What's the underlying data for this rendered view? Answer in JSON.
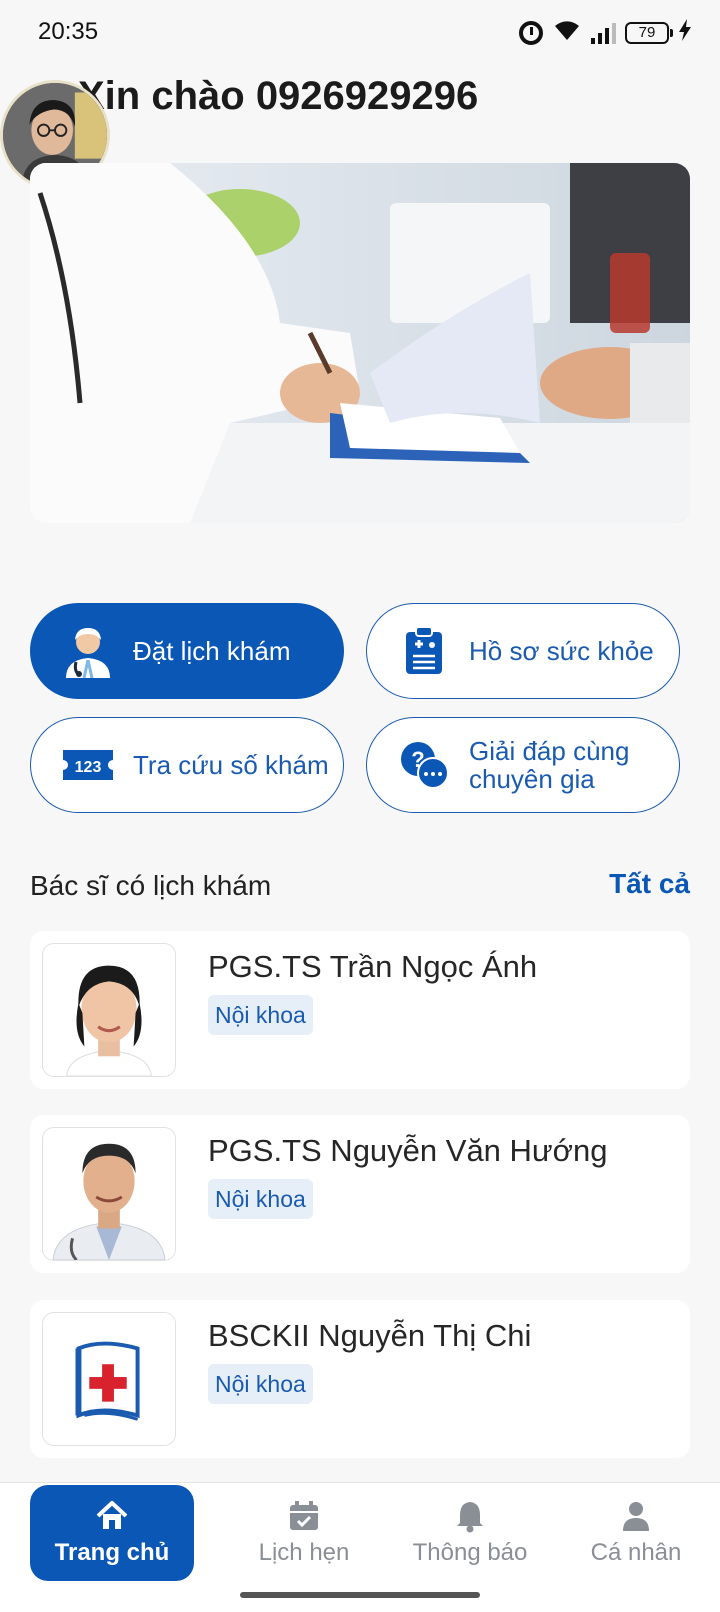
{
  "status_bar": {
    "time": "20:35",
    "battery": "79",
    "icons": [
      "alarm-icon",
      "wifi-icon",
      "signal-icon",
      "battery-icon",
      "charging-icon"
    ]
  },
  "header": {
    "greeting": "Xin chào 0926929296"
  },
  "actions": [
    {
      "label": "Đặt lịch khám",
      "icon": "doctor-icon",
      "primary": true
    },
    {
      "label": "Hồ sơ sức khỏe",
      "icon": "clipboard-icon",
      "primary": false
    },
    {
      "label": "Tra cứu số khám",
      "icon": "ticket-number-icon",
      "primary": false
    },
    {
      "label": "Giải đáp cùng chuyên gia",
      "icon": "question-chat-icon",
      "primary": false
    }
  ],
  "doctors_section": {
    "title": "Bác sĩ có lịch khám",
    "see_all": "Tất cả",
    "doctors": [
      {
        "name": "PGS.TS Trần Ngọc Ánh",
        "specialty": "Nội khoa"
      },
      {
        "name": "PGS.TS Nguyễn Văn Hướng",
        "specialty": "Nội khoa"
      },
      {
        "name": "BSCKII Nguyễn Thị Chi",
        "specialty": "Nội khoa"
      }
    ]
  },
  "bottom_nav": [
    {
      "label": "Trang chủ",
      "icon": "home-icon",
      "active": true
    },
    {
      "label": "Lịch hẹn",
      "icon": "calendar-icon",
      "active": false
    },
    {
      "label": "Thông báo",
      "icon": "bell-icon",
      "active": false
    },
    {
      "label": "Cá nhân",
      "icon": "person-icon",
      "active": false
    }
  ],
  "colors": {
    "primary": "#0b57b5",
    "background": "#f7f7f7",
    "tag_bg": "#e6eef8"
  }
}
